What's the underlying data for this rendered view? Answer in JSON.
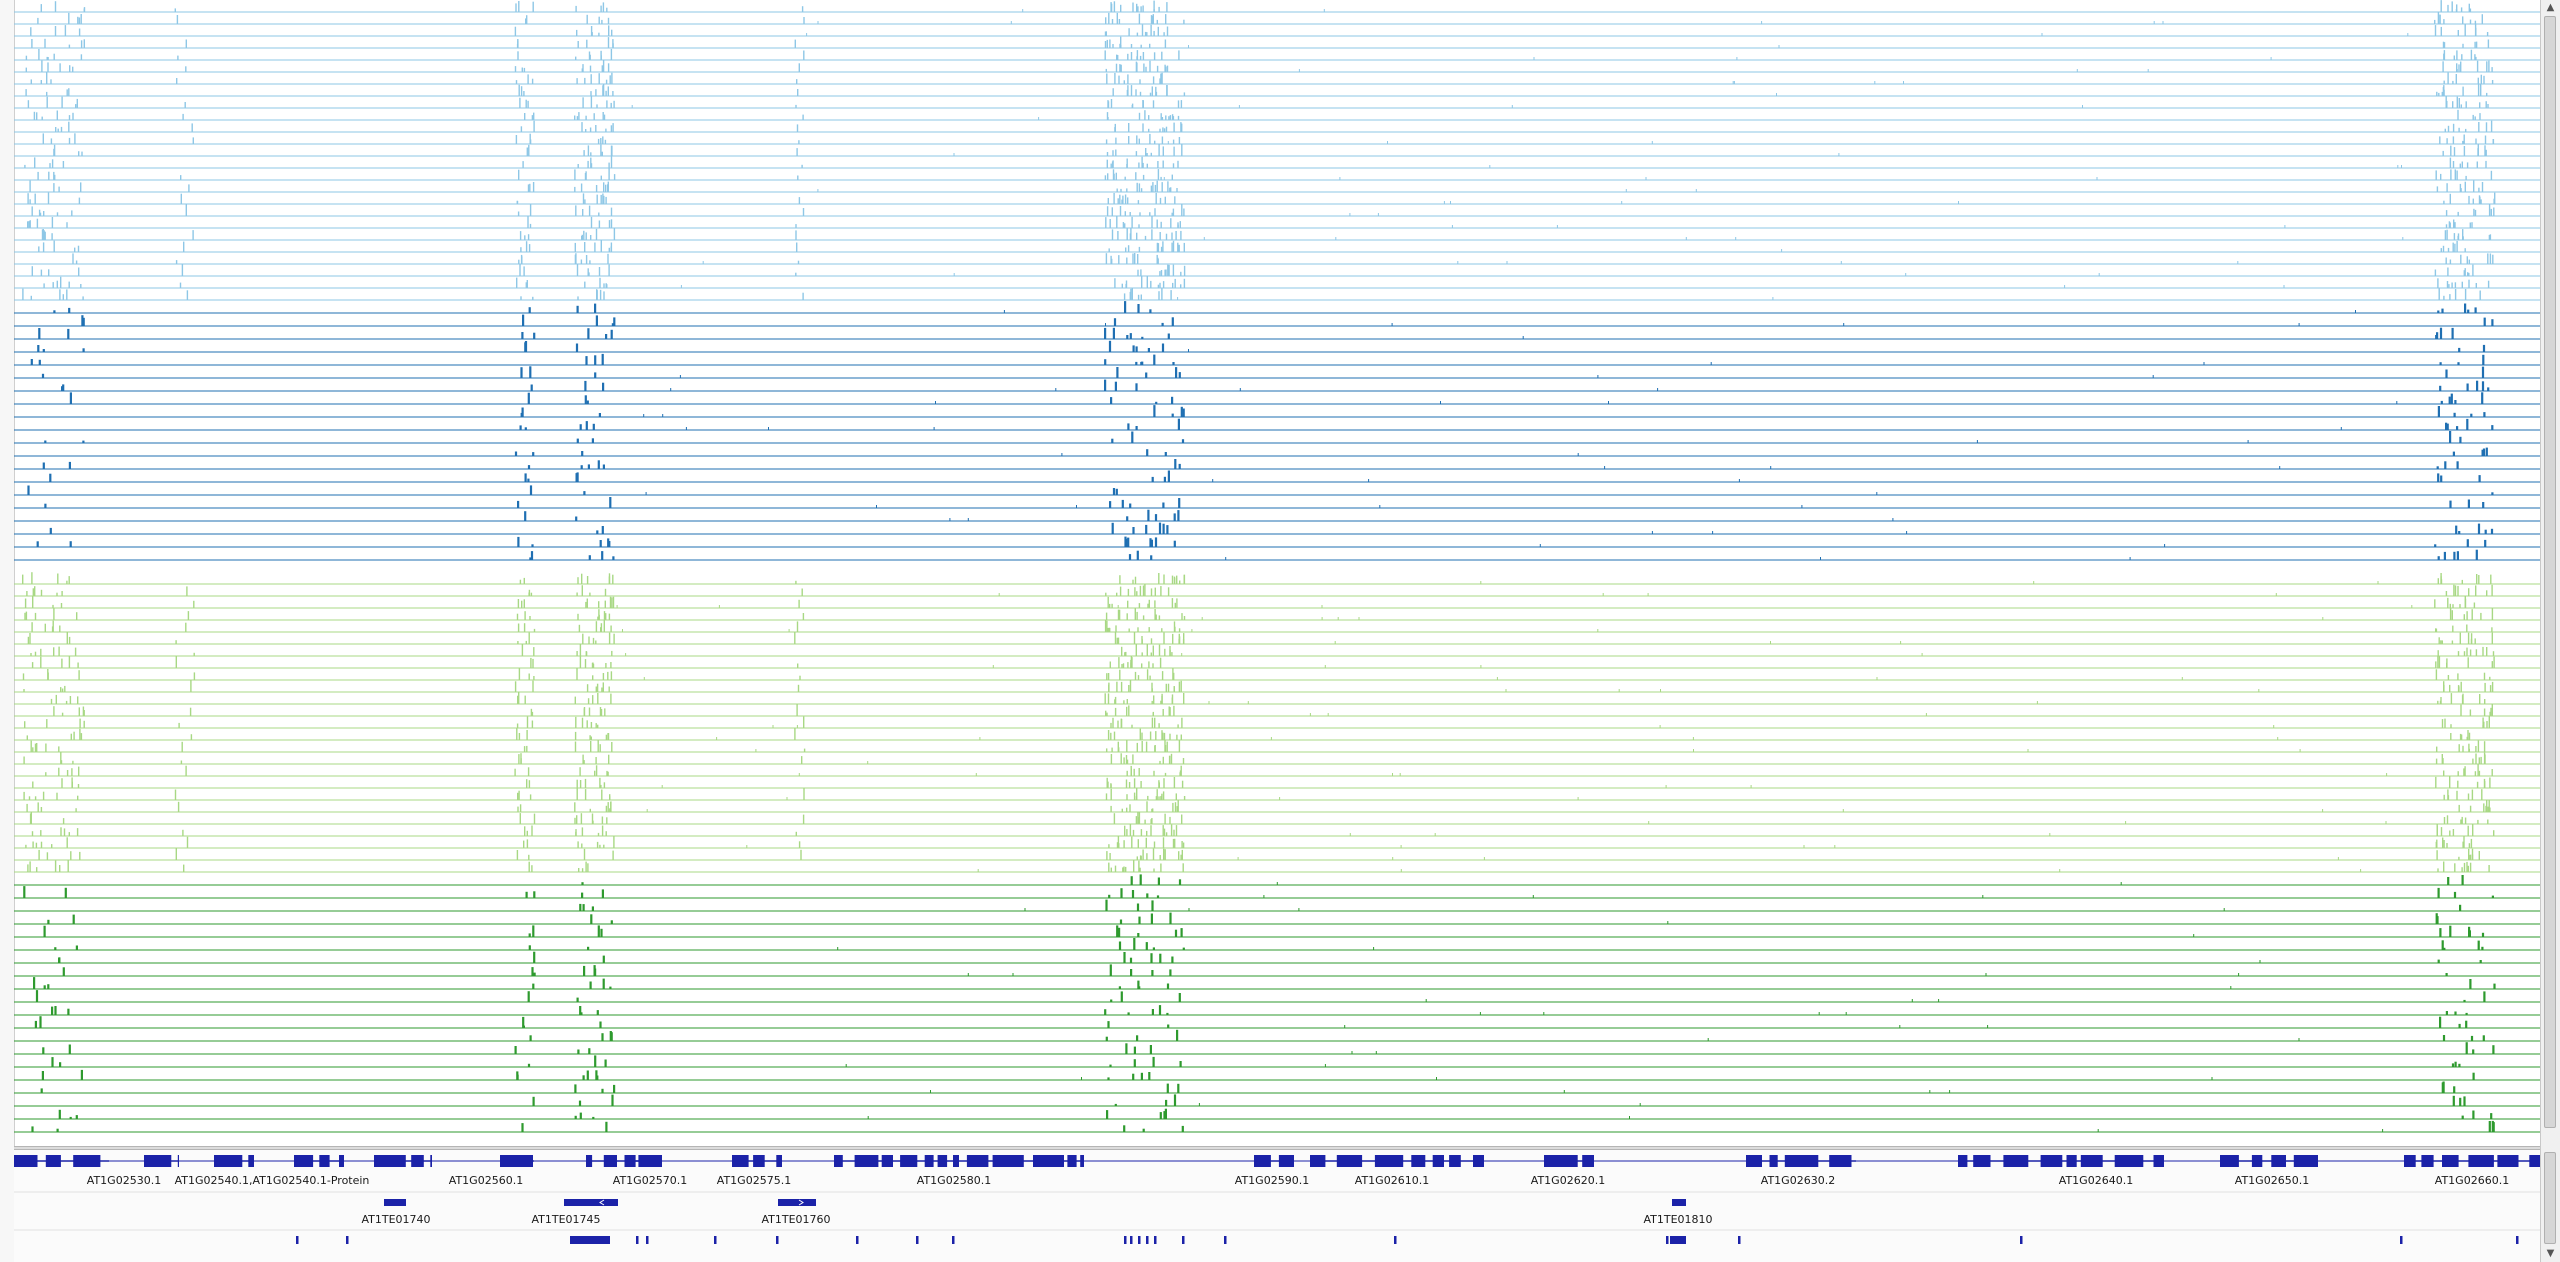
{
  "colors": {
    "light_blue": "#8ec7e6",
    "dark_blue": "#1f6fb2",
    "light_green": "#a8d884",
    "dark_green": "#2e9a2e",
    "gene": "#1b22a8"
  },
  "icons": {
    "scroll_up": "up-arrow",
    "scroll_down": "down-arrow"
  },
  "genes": [
    {
      "label": "AT1G02530.1"
    },
    {
      "label": "AT1G02540.1,AT1G02540.1-Protein"
    },
    {
      "label": "AT1G02560.1"
    },
    {
      "label": "AT1G02570.1"
    },
    {
      "label": "AT1G02575.1"
    },
    {
      "label": "AT1G02580.1"
    },
    {
      "label": "AT1G02590.1"
    },
    {
      "label": "AT1G02610.1"
    },
    {
      "label": "AT1G02620.1"
    },
    {
      "label": "AT1G02630.2"
    },
    {
      "label": "AT1G02640.1"
    },
    {
      "label": "AT1G02650.1"
    },
    {
      "label": "AT1G02660.1"
    }
  ],
  "transposons": [
    {
      "label": "AT1TE01740"
    },
    {
      "label": "AT1TE01745"
    },
    {
      "label": "AT1TE01760"
    },
    {
      "label": "AT1TE01810"
    }
  ]
}
